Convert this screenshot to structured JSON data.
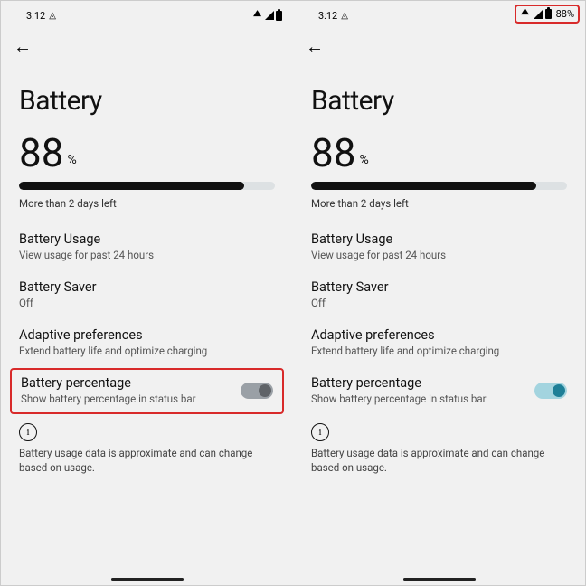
{
  "left": {
    "status": {
      "time": "3:12",
      "showPct": false,
      "pct": ""
    },
    "title": "Battery",
    "pctNum": "88",
    "pctSym": "%",
    "estimate": "More than 2 days left",
    "usage": {
      "t": "Battery Usage",
      "d": "View usage for past 24 hours"
    },
    "saver": {
      "t": "Battery Saver",
      "d": "Off"
    },
    "adaptive": {
      "t": "Adaptive preferences",
      "d": "Extend battery life and optimize charging"
    },
    "percent": {
      "t": "Battery percentage",
      "d": "Show battery percentage in status bar"
    },
    "foot": "Battery usage data is approximate and can change based on usage."
  },
  "right": {
    "status": {
      "time": "3:12",
      "showPct": true,
      "pct": "88%"
    },
    "title": "Battery",
    "pctNum": "88",
    "pctSym": "%",
    "estimate": "More than 2 days left",
    "usage": {
      "t": "Battery Usage",
      "d": "View usage for past 24 hours"
    },
    "saver": {
      "t": "Battery Saver",
      "d": "Off"
    },
    "adaptive": {
      "t": "Adaptive preferences",
      "d": "Extend battery life and optimize charging"
    },
    "percent": {
      "t": "Battery percentage",
      "d": "Show battery percentage in status bar"
    },
    "foot": "Battery usage data is approximate and can change based on usage."
  }
}
